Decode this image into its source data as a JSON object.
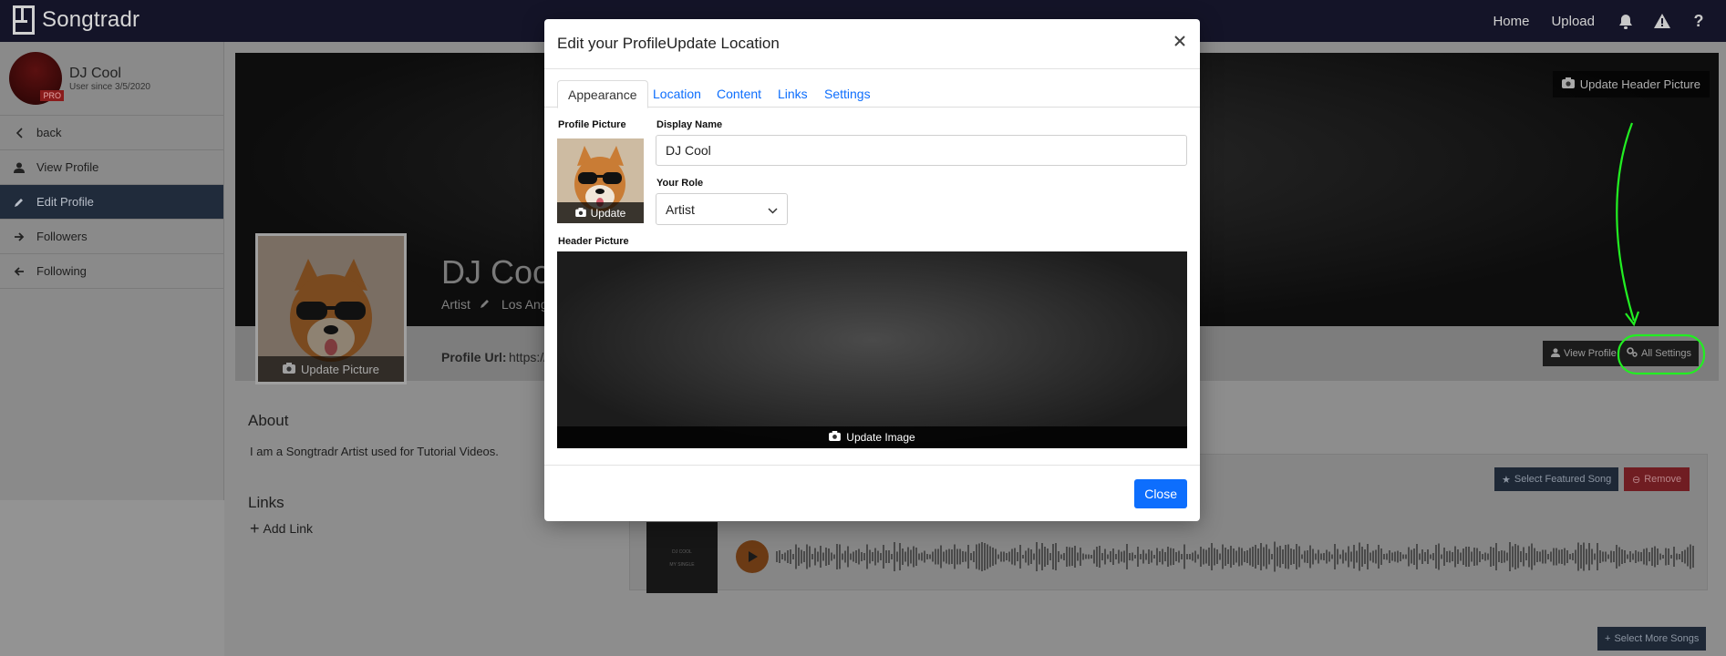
{
  "topbar": {
    "brand": "Songtradr",
    "nav": {
      "home": "Home",
      "upload": "Upload"
    },
    "icons": [
      "bell-icon",
      "warning-icon",
      "help-icon"
    ]
  },
  "sidebar": {
    "user_name": "DJ Cool",
    "user_since": "User since 3/5/2020",
    "badge": "PRO",
    "items": [
      {
        "label": "back",
        "icon": "chevron-left-icon"
      },
      {
        "label": "View Profile",
        "icon": "user-icon"
      },
      {
        "label": "Edit Profile",
        "icon": "pencil-icon",
        "active": true
      },
      {
        "label": "Followers",
        "icon": "arrow-right-icon"
      },
      {
        "label": "Following",
        "icon": "arrow-left-icon"
      }
    ]
  },
  "profile": {
    "header_update_label": "Update Header Picture",
    "picture_update_label": "Update Picture",
    "name": "DJ Cool",
    "role": "Artist",
    "location": "Los Ang",
    "url_label": "Profile Url:",
    "url_value": "https://v",
    "view_profile_label": "View Profile",
    "all_settings_label": "All Settings",
    "about_heading": "About",
    "about_text": "I am a Songtradr Artist used for Tutorial Videos.",
    "links_heading": "Links",
    "add_link_label": "Add Link"
  },
  "song": {
    "select_featured_label": "Select Featured Song",
    "remove_label": "Remove",
    "art_line1": "DJ COOL",
    "art_line2": "MY SINGLE",
    "select_more_label": "Select More Songs"
  },
  "modal": {
    "title": "Edit your ProfileUpdate Location",
    "tabs": [
      "Appearance",
      "Location",
      "Content",
      "Links",
      "Settings"
    ],
    "active_tab": "Appearance",
    "profile_picture_label": "Profile Picture",
    "profile_picture_update": "Update",
    "display_name_label": "Display Name",
    "display_name_value": "DJ Cool",
    "role_label": "Your Role",
    "role_value": "Artist",
    "header_picture_label": "Header Picture",
    "update_image_label": "Update Image",
    "close_label": "Close"
  },
  "colors": {
    "accent": "#0d6efd",
    "topbar": "#141428",
    "annotation": "#22ee22"
  }
}
